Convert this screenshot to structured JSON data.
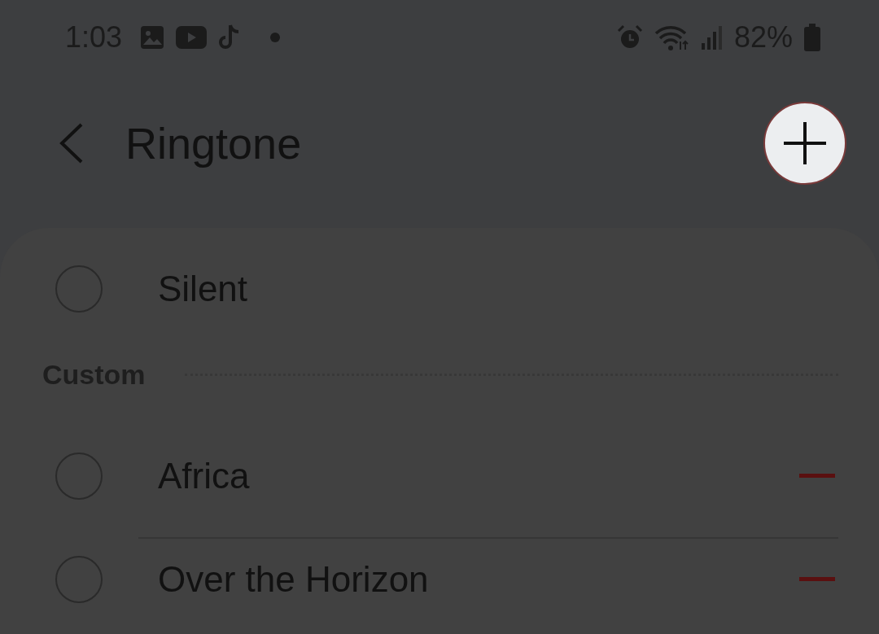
{
  "status_bar": {
    "time": "1:03",
    "battery": "82%"
  },
  "header": {
    "title": "Ringtone"
  },
  "options": [
    {
      "label": "Silent",
      "selected": false,
      "removable": false
    }
  ],
  "sections": [
    {
      "title": "Custom",
      "items": [
        {
          "label": "Africa",
          "selected": false,
          "removable": true
        },
        {
          "label": "Over the Horizon",
          "selected": false,
          "removable": true
        }
      ]
    }
  ]
}
